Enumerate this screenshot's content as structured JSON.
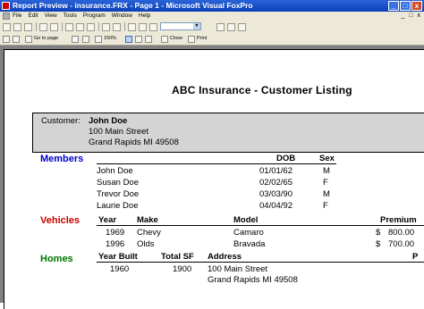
{
  "window": {
    "title": "Report Preview - insurance.FRX - Page 1 - Microsoft Visual FoxPro",
    "min": "_",
    "max": "□",
    "close": "x"
  },
  "menu": {
    "items": [
      "File",
      "Edit",
      "View",
      "Tools",
      "Program",
      "Window",
      "Help"
    ],
    "right": [
      "_",
      "□",
      "x"
    ]
  },
  "toolbar2": {
    "goto": "Go to page",
    "zoom": "150%",
    "close": "Close",
    "print": "Print"
  },
  "report": {
    "title": "ABC Insurance - Customer Listing",
    "customer_label": "Customer:",
    "customer_name": "John Doe",
    "address1": "100 Main Street",
    "address2": "Grand Rapids MI 49508",
    "members": {
      "title": "Members",
      "headers": [
        "Name",
        "DOB",
        "Sex"
      ],
      "rows": [
        [
          "John Doe",
          "01/01/62",
          "M"
        ],
        [
          "Susan Doe",
          "02/02/65",
          "F"
        ],
        [
          "Trevor Doe",
          "03/03/90",
          "M"
        ],
        [
          "Laurie Doe",
          "04/04/92",
          "F"
        ]
      ]
    },
    "vehicles": {
      "title": "Vehicles",
      "headers": [
        "Year",
        "Make",
        "Model",
        "Premium"
      ],
      "rows": [
        [
          "1969",
          "Chevy",
          "Camaro",
          "$",
          "800.00"
        ],
        [
          "1996",
          "Olds",
          "Bravada",
          "$",
          "700.00"
        ]
      ]
    },
    "homes": {
      "title": "Homes",
      "headers": [
        "Year Built",
        "Total SF",
        "Address",
        "P"
      ],
      "rows": [
        [
          "1960",
          "1900",
          "100 Main Street",
          "Grand Rapids MI 49508"
        ]
      ]
    }
  },
  "colors": {
    "members": "#0000c8",
    "vehicles": "#c80000",
    "homes": "#007800"
  }
}
